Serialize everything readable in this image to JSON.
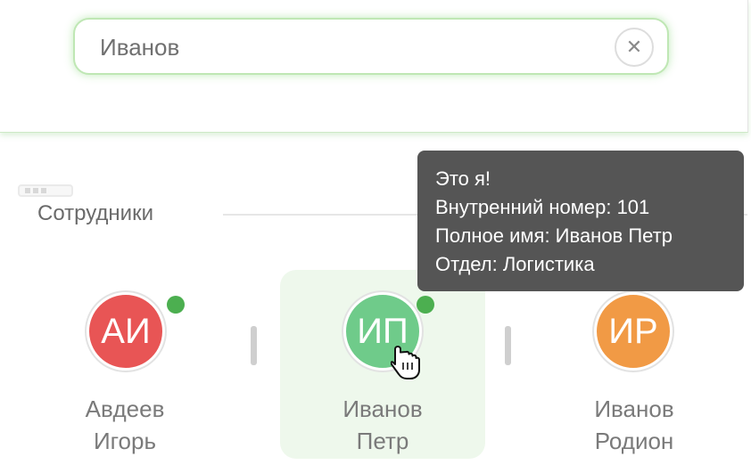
{
  "search": {
    "value": "Иванов",
    "clear_icon": "close-icon"
  },
  "section": {
    "title": "Сотрудники"
  },
  "employees": [
    {
      "initials": "АИ",
      "first_line": "Авдеев",
      "second_line": "Игорь",
      "avatar_color": "#e85555",
      "online": true,
      "selected": false
    },
    {
      "initials": "ИП",
      "first_line": "Иванов",
      "second_line": "Петр",
      "avatar_color": "#6fcb8a",
      "online": true,
      "selected": true
    },
    {
      "initials": "ИР",
      "first_line": "Иванов",
      "second_line": "Родион",
      "avatar_color": "#f19a45",
      "online": false,
      "selected": false
    }
  ],
  "tooltip": {
    "line1": "Это я!",
    "line2": "Внутренний номер: 101",
    "line3": "Полное имя: Иванов Петр",
    "line4": "Отдел: Логистика"
  },
  "colors": {
    "accent_green": "#4caf50",
    "selected_background": "#eef8ec",
    "tooltip_background": "#555555",
    "search_glow": "#bfe7b4"
  },
  "cursor": "hand-pointer-icon"
}
